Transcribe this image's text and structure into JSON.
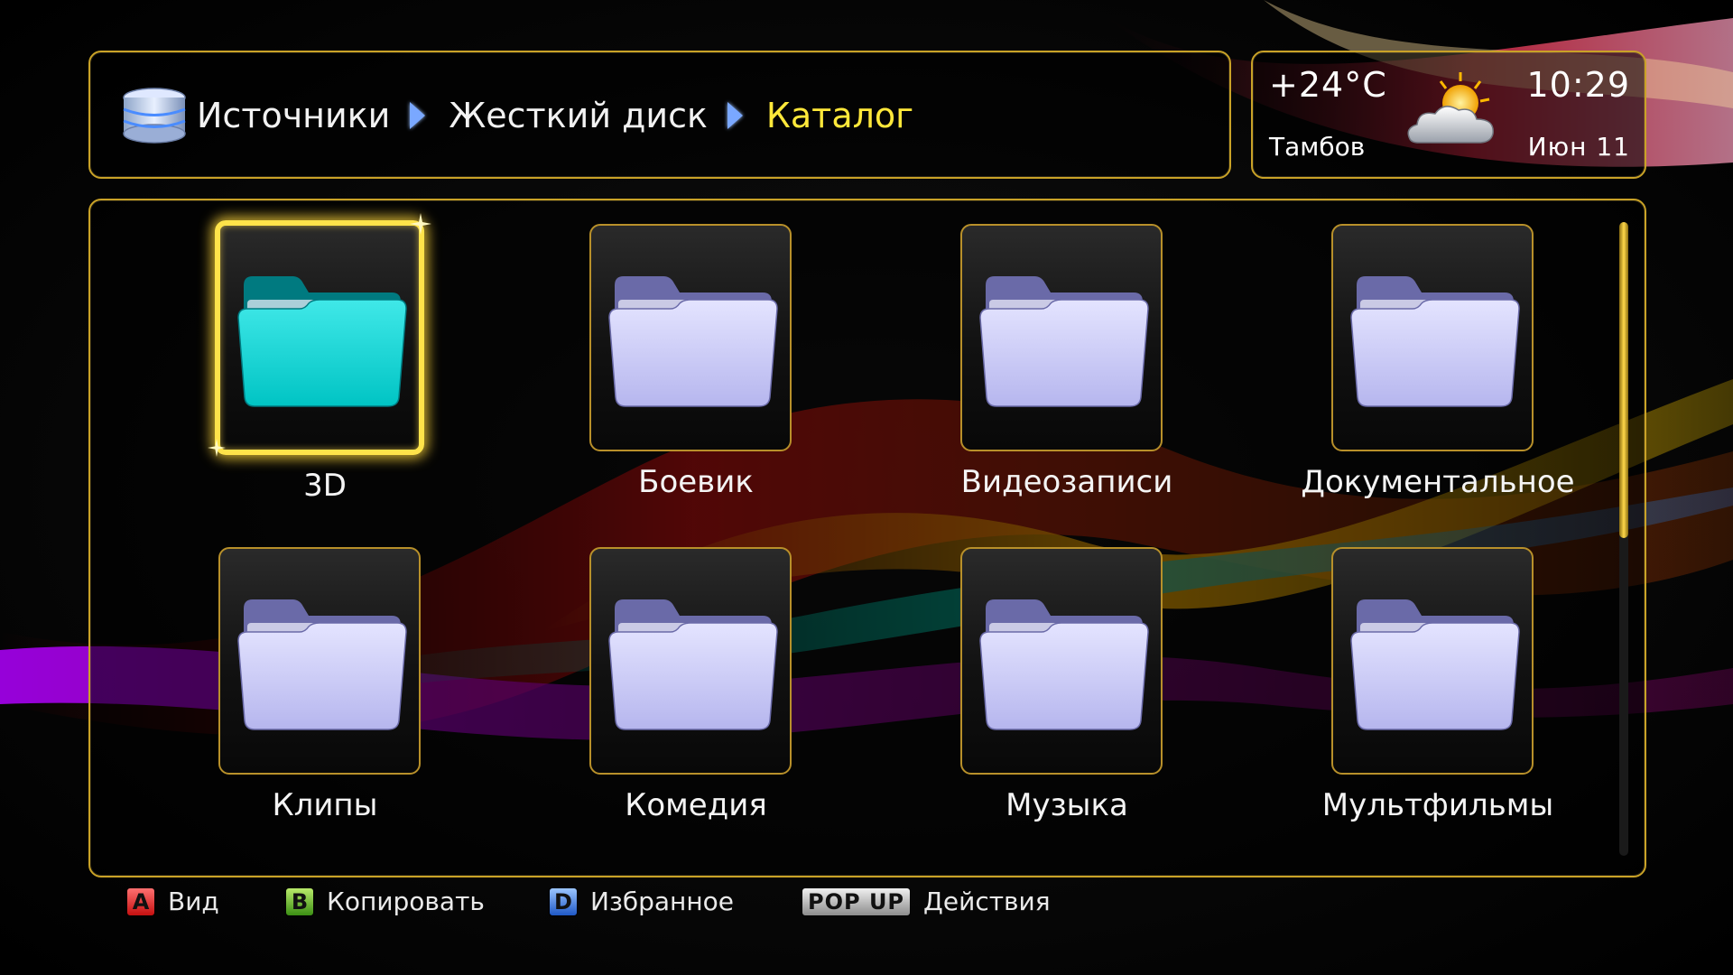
{
  "header": {
    "breadcrumb": [
      "Источники",
      "Жесткий диск",
      "Каталог"
    ],
    "source_icon": "database-icon"
  },
  "weather": {
    "temperature": "+24°C",
    "city": "Тамбов",
    "time": "10:29",
    "date": "Июн 11",
    "icon": "partly-cloudy-icon"
  },
  "folders": [
    {
      "label": "3D",
      "selected": true
    },
    {
      "label": "Боевик",
      "selected": false
    },
    {
      "label": "Видеозаписи",
      "selected": false
    },
    {
      "label": "Документальное",
      "selected": false
    },
    {
      "label": "Клипы",
      "selected": false
    },
    {
      "label": "Комедия",
      "selected": false
    },
    {
      "label": "Музыка",
      "selected": false
    },
    {
      "label": "Мультфильмы",
      "selected": false
    }
  ],
  "scroll": {
    "position": 0.0
  },
  "footer": [
    {
      "key": "A",
      "label": "Вид",
      "color": "#e02020"
    },
    {
      "key": "B",
      "label": "Копировать",
      "color": "#5cb82a"
    },
    {
      "key": "D",
      "label": "Избранное",
      "color": "#2d6fe0"
    },
    {
      "key": "POP UP",
      "label": "Действия",
      "color": "#c8c8c8"
    }
  ],
  "colors": {
    "accent": "#c9a227",
    "selection": "#ffe34a",
    "breadcrumb_current": "#ffe83a",
    "folder_default": "#b6b6ee",
    "folder_selected": "#00c4c4"
  }
}
